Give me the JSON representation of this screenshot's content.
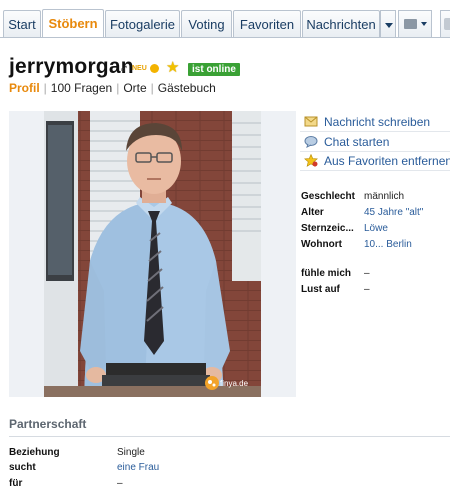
{
  "tabs": [
    {
      "label": "Start"
    },
    {
      "label": "Stöbern",
      "active": true
    },
    {
      "label": "Fotogalerie"
    },
    {
      "label": "Voting"
    },
    {
      "label": "Favoriten"
    },
    {
      "label": "Nachrichten"
    }
  ],
  "profile": {
    "username": "jerrymorgan",
    "gender_symbol": "♂",
    "new_badge": "NEU",
    "online_badge": "ist online",
    "subnav": [
      "Profil",
      "100 Fragen",
      "Orte",
      "Gästebuch"
    ]
  },
  "photo": {
    "watermark": "finya.de"
  },
  "actions": [
    {
      "label": "Nachricht schreiben",
      "icon": "envelope-icon"
    },
    {
      "label": "Chat starten",
      "icon": "chat-bubble-icon"
    },
    {
      "label": "Aus Favoriten entfernen",
      "icon": "star-remove-icon"
    }
  ],
  "details": [
    {
      "label": "Geschlecht",
      "value": "männlich"
    },
    {
      "label": "Alter",
      "value": "45 Jahre \"alt\""
    },
    {
      "label": "Sternzeic...",
      "value": "Löwe"
    },
    {
      "label": "Wohnort",
      "value": "10... Berlin"
    },
    {
      "label": "fühle mich",
      "value": "–"
    },
    {
      "label": "Lust auf",
      "value": "–"
    }
  ],
  "partnerschaft": {
    "title": "Partnerschaft",
    "rows": [
      {
        "label": "Beziehung",
        "value": "Single"
      },
      {
        "label": "sucht",
        "value": "eine Frau"
      },
      {
        "label": "für",
        "value": "–"
      }
    ]
  },
  "colors": {
    "accent_orange": "#e8890c",
    "link_blue": "#2a5c9a",
    "online_green": "#3aa135"
  }
}
